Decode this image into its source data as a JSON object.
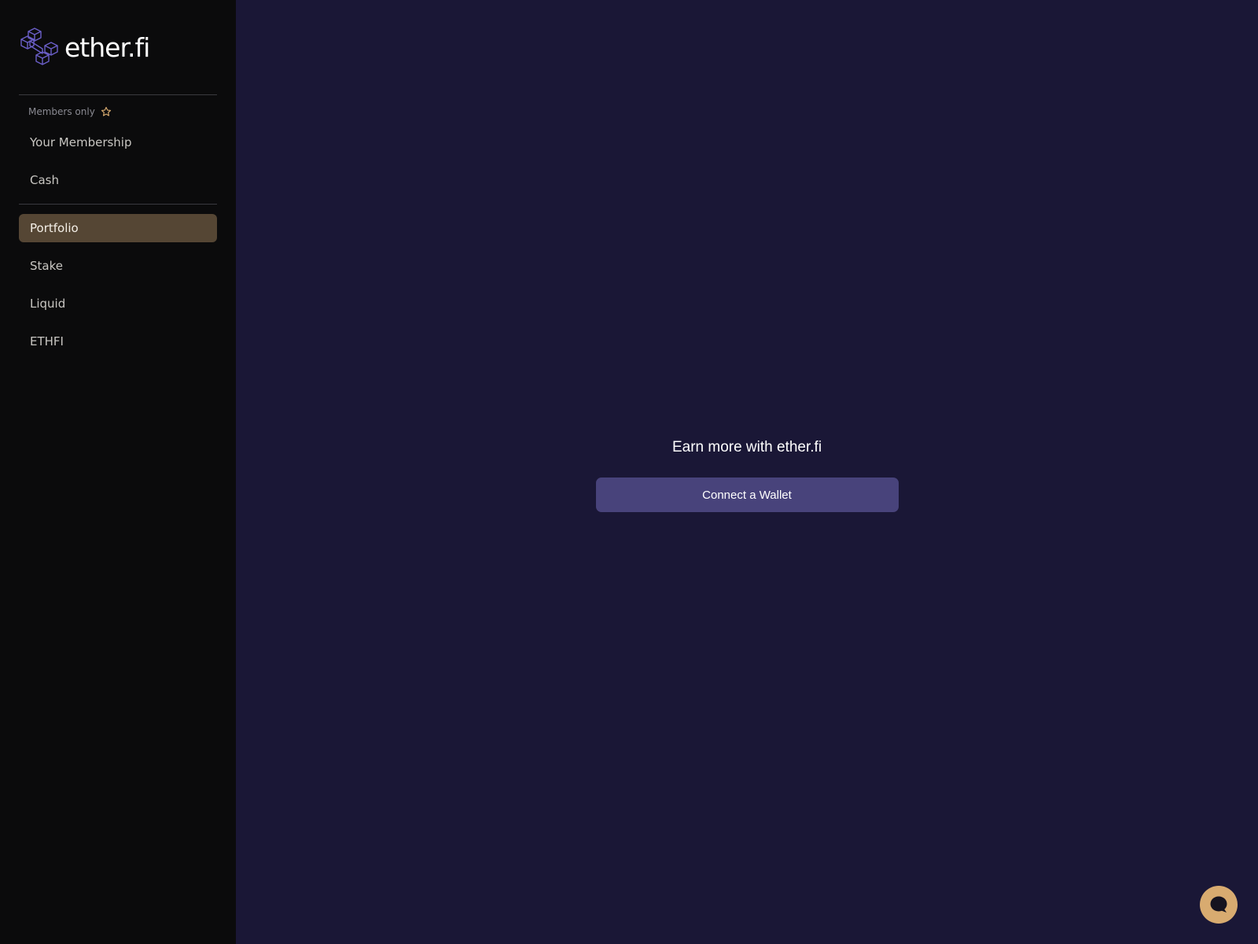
{
  "brand": {
    "name": "ether.fi",
    "logo_icon": "etherfi-cube-logo-icon",
    "accent": "#6b5fc8"
  },
  "sidebar": {
    "members_section": {
      "label": "Members only",
      "icon": "star-icon",
      "items": [
        {
          "label": "Your Membership"
        },
        {
          "label": "Cash"
        }
      ]
    },
    "main_items": [
      {
        "label": "Portfolio",
        "active": true
      },
      {
        "label": "Stake"
      },
      {
        "label": "Liquid"
      },
      {
        "label": "ETHFI"
      }
    ],
    "active_color": "#554634"
  },
  "main": {
    "title": "Earn more with ether.fi",
    "connect_button_label": "Connect a Wallet",
    "button_color": "#48437b",
    "background": "#1a1736"
  },
  "chat": {
    "icon": "chat-bubble-icon",
    "color": "#d8ab70"
  }
}
